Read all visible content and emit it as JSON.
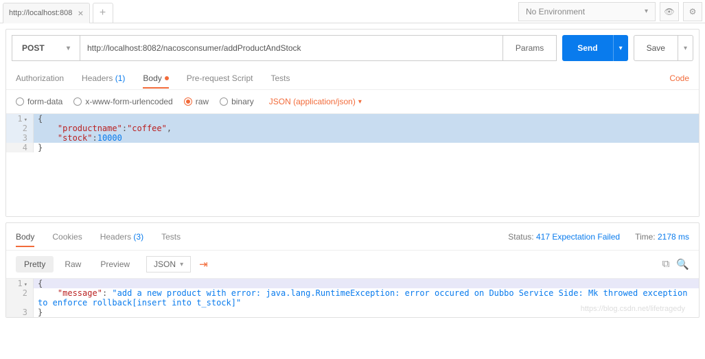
{
  "top": {
    "tab_label": "http://localhost:808",
    "env": "No Environment"
  },
  "request": {
    "method": "POST",
    "url": "http://localhost:8082/nacosconsumer/addProductAndStock",
    "params_btn": "Params",
    "send_btn": "Send",
    "save_btn": "Save"
  },
  "req_tabs": {
    "auth": "Authorization",
    "headers": "Headers",
    "headers_count": "(1)",
    "body": "Body",
    "prereq": "Pre-request Script",
    "tests": "Tests",
    "code": "Code"
  },
  "body_opts": {
    "formdata": "form-data",
    "urlencoded": "x-www-form-urlencoded",
    "raw": "raw",
    "binary": "binary",
    "content_type": "JSON (application/json)"
  },
  "req_body": {
    "l1": "{",
    "l2_k1": "\"productname\"",
    "l2_v1": "\"coffee\"",
    "l3_k1": "\"stock\"",
    "l3_v1": "10000",
    "l4": "}"
  },
  "resp_tabs": {
    "body": "Body",
    "cookies": "Cookies",
    "headers": "Headers",
    "headers_count": "(3)",
    "tests": "Tests"
  },
  "status": {
    "label": "Status:",
    "value": "417 Expectation Failed",
    "time_label": "Time:",
    "time_value": "2178 ms"
  },
  "resp_tools": {
    "pretty": "Pretty",
    "raw": "Raw",
    "preview": "Preview",
    "fmt": "JSON"
  },
  "resp_body": {
    "l1": "{",
    "l2_k": "\"message\"",
    "l2_v": "\"add a new product with error: java.lang.RuntimeException: error occured on Dubbo Service Side: Mk throwed exception to enforce rollback[insert into t_stock]\"",
    "l3": "}"
  },
  "watermark": "https://blog.csdn.net/lifetragedy"
}
